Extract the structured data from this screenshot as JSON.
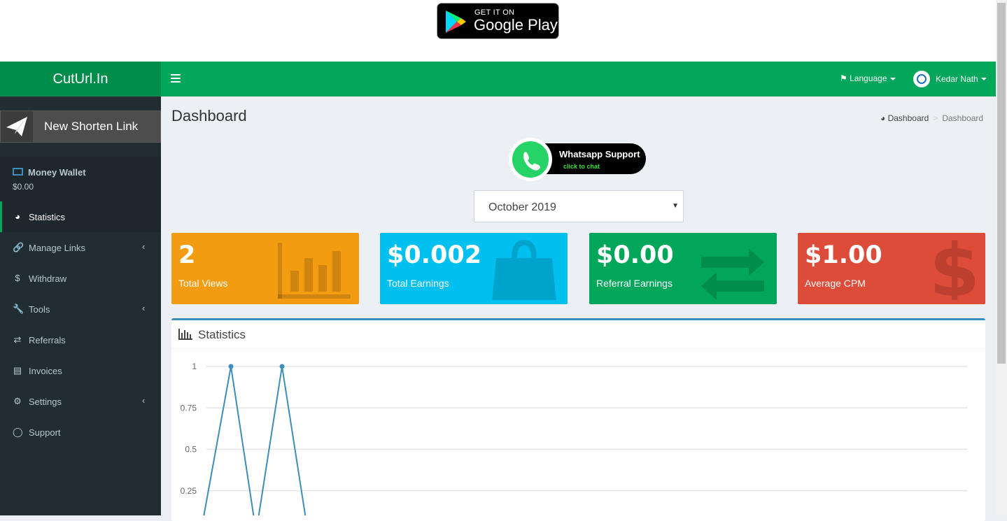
{
  "banner": {
    "store_small": "GET IT ON",
    "store_big": "Google Play"
  },
  "header": {
    "logo": "CutUrl.In",
    "language_label": "Language",
    "user_name": "Kedar Nath"
  },
  "sidebar": {
    "new_link_label": "New Shorten Link",
    "wallet_title": "Money Wallet",
    "wallet_value": "$0.00",
    "items": [
      {
        "label": "Statistics",
        "icon": "dashboard-icon",
        "active": true
      },
      {
        "label": "Manage Links",
        "icon": "link-icon",
        "has_children": true
      },
      {
        "label": "Withdraw",
        "icon": "dollar-icon"
      },
      {
        "label": "Tools",
        "icon": "wrench-icon",
        "has_children": true
      },
      {
        "label": "Referrals",
        "icon": "exchange-icon"
      },
      {
        "label": "Invoices",
        "icon": "credit-card-icon"
      },
      {
        "label": "Settings",
        "icon": "gears-icon",
        "has_children": true
      },
      {
        "label": "Support",
        "icon": "life-ring-icon"
      }
    ]
  },
  "page": {
    "title": "Dashboard",
    "breadcrumb": [
      "Dashboard",
      "Dashboard"
    ],
    "whatsapp_title": "Whatsapp Support",
    "whatsapp_sub": "click to chat",
    "month_select": "October 2019"
  },
  "info_boxes": [
    {
      "value": "2",
      "label": "Total Views",
      "color": "#f39c12",
      "icon": "bar-chart-icon"
    },
    {
      "value": "$0.002",
      "label": "Total Earnings",
      "color": "#00c0ef",
      "icon": "shopping-bag-icon"
    },
    {
      "value": "$0.00",
      "label": "Referral Earnings",
      "color": "#00a65a",
      "icon": "exchange-icon"
    },
    {
      "value": "$1.00",
      "label": "Average CPM",
      "color": "#dd4b39",
      "icon": "dollar-icon"
    }
  ],
  "stats_box": {
    "title": "Statistics"
  },
  "chart_data": {
    "type": "line",
    "y_ticks": [
      "1",
      "0.75",
      "0.5",
      "0.25"
    ],
    "ylim": [
      0,
      1
    ],
    "series": [
      {
        "values": [
          0,
          1,
          0,
          1,
          0
        ]
      }
    ],
    "line_color": "#3c8dbc"
  }
}
